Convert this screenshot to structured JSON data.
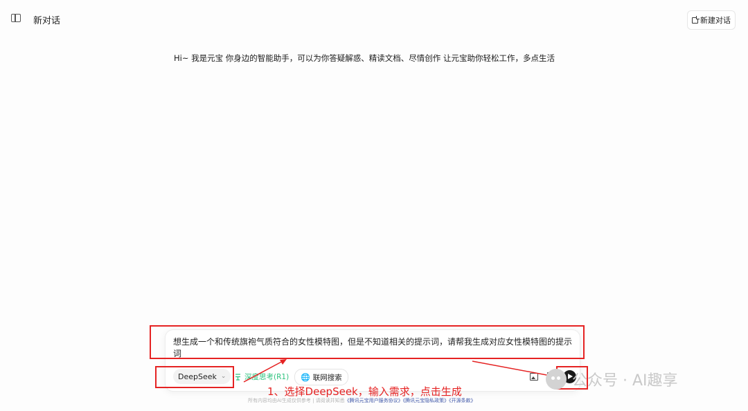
{
  "header": {
    "title": "新对话",
    "new_chat_label": "新建对话",
    "sidebar_icon": "sidebar-toggle-icon"
  },
  "greeting": "Hi~ 我是元宝 你身边的智能助手，可以为你答疑解惑、精读文档、尽情创作 让元宝助你轻松工作，多点生活",
  "composer": {
    "prompt": "想生成一个和传统旗袍气质符合的女性模特图，但是不知道相关的提示词，请帮我生成对应女性模特图的提示词",
    "model": "DeepSeek",
    "deep_think_label": "深度思考(R1)",
    "web_search_label": "联网搜索",
    "icons": [
      "chevron-down-icon",
      "deep-think-icon",
      "globe-icon",
      "image-upload-icon",
      "file-upload-icon",
      "send-icon"
    ]
  },
  "footer": {
    "disclaimer": "所有内容均由AI生成仅供参考 | 请阅读并知悉",
    "link_terms": "《腾讯元宝用户服务协议》",
    "link_privacy": "《腾讯元宝隐私政策》",
    "link_open_source": "《开源条款》"
  },
  "annotation": {
    "text": "1、选择DeepSeek，输入需求，点击生成",
    "color": "#e52222"
  },
  "watermark": {
    "text": "公众号 · AI趣享"
  },
  "colors": {
    "accent_green": "#2ec27e",
    "annotation_red": "#e52222",
    "send_button": "#1a1a1a"
  }
}
